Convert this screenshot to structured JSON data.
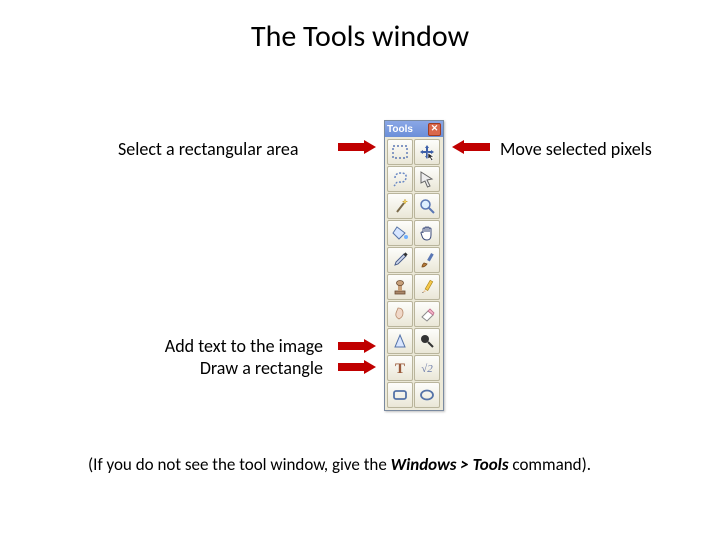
{
  "title": "The Tools window",
  "labels": {
    "select_rect": "Select a rectangular area",
    "move_pixels": "Move selected pixels",
    "add_text": "Add text to the image",
    "draw_rect": "Draw a rectangle"
  },
  "footnote": {
    "prefix": "(If you do not see the tool window, give the ",
    "menu_path": "Windows > Tools",
    "suffix": " command)."
  },
  "tools_palette": {
    "title": "Tools",
    "close": "✕",
    "items": [
      {
        "name": "rect-select-tool",
        "selected": false
      },
      {
        "name": "move-tool",
        "selected": false
      },
      {
        "name": "lasso-tool",
        "selected": false
      },
      {
        "name": "arrow-tool",
        "selected": false
      },
      {
        "name": "wand-tool",
        "selected": false
      },
      {
        "name": "zoom-tool",
        "selected": false
      },
      {
        "name": "fill-tool",
        "selected": false
      },
      {
        "name": "hand-tool",
        "selected": false
      },
      {
        "name": "eyedropper-tool",
        "selected": false
      },
      {
        "name": "brush-tool",
        "selected": false
      },
      {
        "name": "stamp-tool",
        "selected": false
      },
      {
        "name": "pencil-tool",
        "selected": false
      },
      {
        "name": "smudge-tool",
        "selected": false
      },
      {
        "name": "eraser-tool",
        "selected": false
      },
      {
        "name": "sharpen-tool",
        "selected": false
      },
      {
        "name": "dodge-tool",
        "selected": false
      },
      {
        "name": "text-tool",
        "selected": false
      },
      {
        "name": "line-tool",
        "selected": false
      },
      {
        "name": "rect-shape-tool",
        "selected": false
      },
      {
        "name": "ellipse-tool",
        "selected": false
      }
    ]
  }
}
